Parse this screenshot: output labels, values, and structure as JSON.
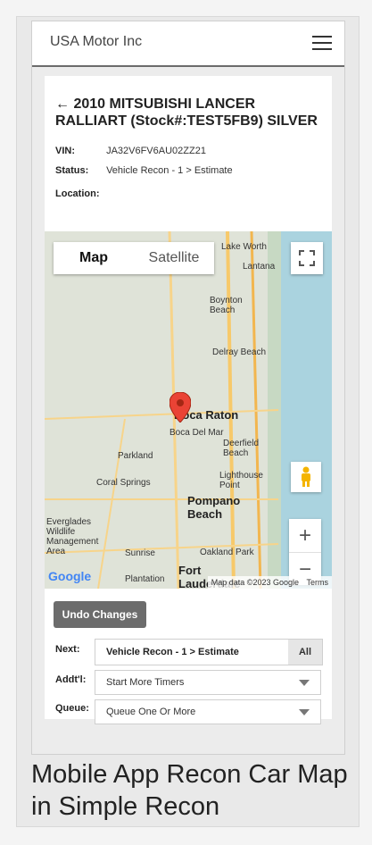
{
  "app": {
    "brand": "USA Motor Inc"
  },
  "vehicle": {
    "title": "← 2010 MITSUBISHI LANCER RALLIART (Stock#:TEST5FB9) SILVER",
    "vin_label": "VIN:",
    "vin": "JA32V6FV6AU02ZZ21",
    "status_label": "Status:",
    "status": "Vehicle Recon - 1 > Estimate",
    "location_label": "Location:"
  },
  "map": {
    "tab_map": "Map",
    "tab_satellite": "Satellite",
    "zoom_in": "+",
    "zoom_out": "−",
    "places": [
      "Lake Worth",
      "Lantana",
      "Boynton Beach",
      "Delray Beach",
      "Boca Raton",
      "Boca Del Mar",
      "Deerfield Beach",
      "Parkland",
      "Lighthouse Point",
      "Coral Springs",
      "Pompano Beach",
      "Everglades Wildlife Management Area",
      "Sunrise",
      "Oakland Park",
      "Plantation",
      "Fort Lauderdale"
    ],
    "google": "Google",
    "attribution": "Map data ©2023 Google",
    "terms": "Terms"
  },
  "actions": {
    "undo": "Undo Changes"
  },
  "form": {
    "next_label": "Next:",
    "next_value": "Vehicle Recon - 1 > Estimate",
    "next_all": "All",
    "addtl_label": "Addt'l:",
    "addtl_value": "Start More Timers",
    "queue_label": "Queue:",
    "queue_value": "Queue One Or More"
  },
  "caption": "Mobile App Recon Car Map in Simple Recon"
}
